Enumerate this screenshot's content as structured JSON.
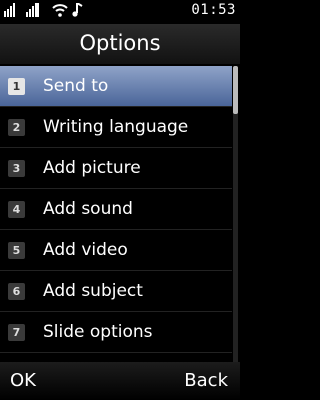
{
  "status": {
    "icons": [
      "signal-icon",
      "signal-2-icon",
      "wifi-icon",
      "music-note-icon"
    ],
    "time": "01:53"
  },
  "header": {
    "title": "Options"
  },
  "menu": {
    "selected_index": 0,
    "items": [
      {
        "number": "1",
        "label": "Send to"
      },
      {
        "number": "2",
        "label": "Writing language"
      },
      {
        "number": "3",
        "label": "Add picture"
      },
      {
        "number": "4",
        "label": "Add sound"
      },
      {
        "number": "5",
        "label": "Add video"
      },
      {
        "number": "6",
        "label": "Add subject"
      },
      {
        "number": "7",
        "label": "Slide options"
      }
    ]
  },
  "softkeys": {
    "left": "OK",
    "right": "Back"
  },
  "colors": {
    "selection": "#6f86b6",
    "background": "#000000"
  }
}
